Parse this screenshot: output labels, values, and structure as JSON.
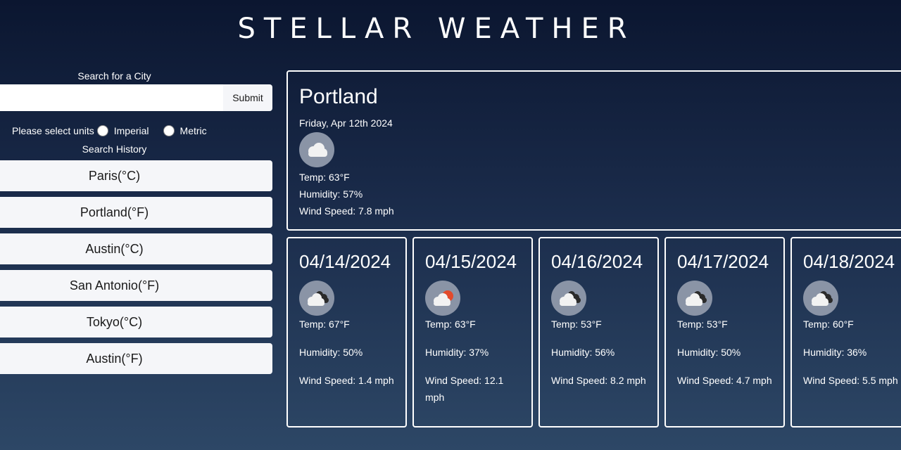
{
  "header": {
    "title": "STELLAR WEATHER"
  },
  "search": {
    "label": "Search for a City",
    "value": "",
    "placeholder": "",
    "submit_label": "Submit"
  },
  "units": {
    "prompt": "Please select units",
    "options": [
      "Imperial",
      "Metric"
    ],
    "selected": null
  },
  "history": {
    "label": "Search History",
    "items": [
      "Paris(°C)",
      "Portland(°F)",
      "Austin(°C)",
      "San Antonio(°F)",
      "Tokyo(°C)",
      "Austin(°F)"
    ]
  },
  "current": {
    "city": "Portland",
    "date": "Friday, Apr 12th 2024",
    "icon": "cloud-icon",
    "temp": "Temp: 63°F",
    "humidity": "Humidity: 57%",
    "wind": "Wind Speed: 7.8 mph"
  },
  "forecast": [
    {
      "date": "04/14/2024",
      "icon": "broken-clouds-icon",
      "temp": "Temp: 67°F",
      "humidity": "Humidity: 50%",
      "wind": "Wind Speed: 1.4 mph"
    },
    {
      "date": "04/15/2024",
      "icon": "partly-cloudy-icon",
      "temp": "Temp: 63°F",
      "humidity": "Humidity: 37%",
      "wind": "Wind Speed: 12.1 mph"
    },
    {
      "date": "04/16/2024",
      "icon": "broken-clouds-icon",
      "temp": "Temp: 53°F",
      "humidity": "Humidity: 56%",
      "wind": "Wind Speed: 8.2 mph"
    },
    {
      "date": "04/17/2024",
      "icon": "broken-clouds-icon",
      "temp": "Temp: 53°F",
      "humidity": "Humidity: 50%",
      "wind": "Wind Speed: 4.7 mph"
    },
    {
      "date": "04/18/2024",
      "icon": "broken-clouds-icon",
      "temp": "Temp: 60°F",
      "humidity": "Humidity: 36%",
      "wind": "Wind Speed: 5.5 mph"
    }
  ]
}
